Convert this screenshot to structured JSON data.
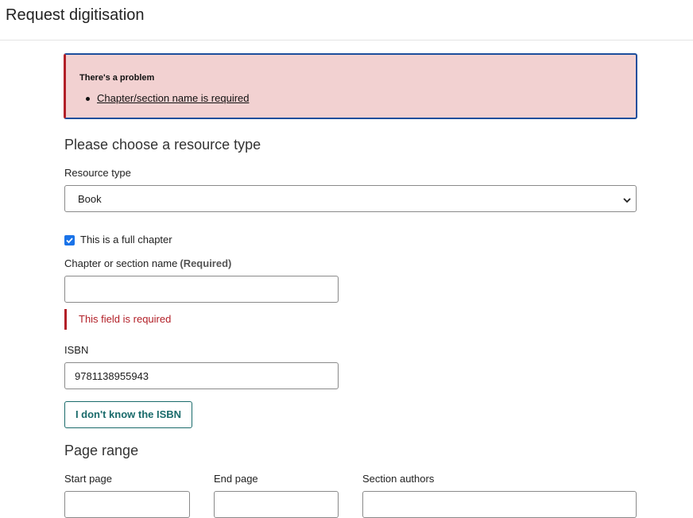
{
  "header": {
    "title": "Request digitisation"
  },
  "error_summary": {
    "title": "There's a problem",
    "items": [
      "Chapter/section name is required"
    ]
  },
  "resource_section": {
    "heading": "Please choose a resource type",
    "resource_type_label": "Resource type",
    "resource_type_value": "Book"
  },
  "full_chapter": {
    "label": "This is a full chapter",
    "checked": true
  },
  "chapter_name": {
    "label": "Chapter or section name",
    "required_tag": "(Required)",
    "value": "",
    "error": "This field is required"
  },
  "isbn": {
    "label": "ISBN",
    "value": "9781138955943",
    "unknown_button": "I don't know the ISBN"
  },
  "page_range": {
    "heading": "Page range",
    "start_label": "Start page",
    "end_label": "End page",
    "authors_label": "Section authors"
  },
  "colors": {
    "error_red": "#b21f27",
    "summary_bg": "#f2d1d1",
    "focus_blue": "#1d4e9c",
    "teal": "#1a6b6b",
    "checkbox_blue": "#1a73e8"
  }
}
